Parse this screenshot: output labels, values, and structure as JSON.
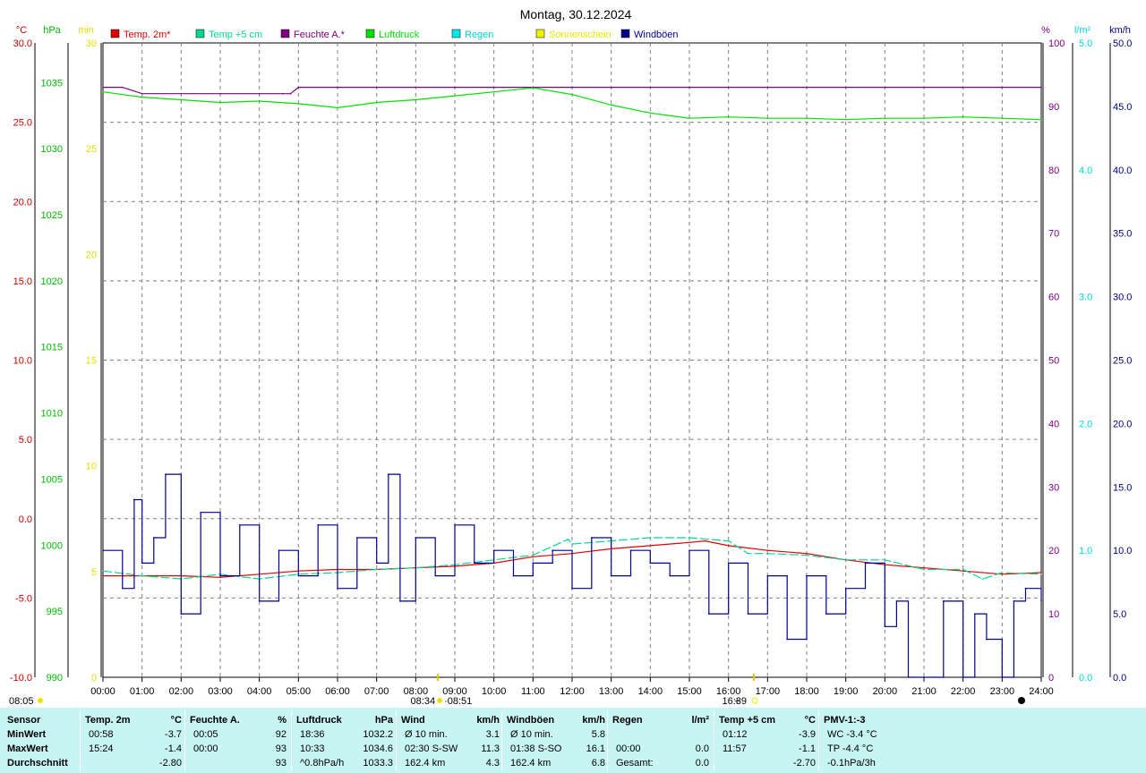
{
  "chart_data": {
    "type": "line",
    "title": "Montag, 30.12.2024",
    "x_ticks": [
      "00:00",
      "01:00",
      "02:00",
      "03:00",
      "04:00",
      "05:00",
      "06:00",
      "07:00",
      "08:00",
      "09:00",
      "10:00",
      "11:00",
      "12:00",
      "13:00",
      "14:00",
      "15:00",
      "16:00",
      "17:00",
      "18:00",
      "19:00",
      "20:00",
      "21:00",
      "22:00",
      "23:00",
      "24:00"
    ],
    "axes": [
      {
        "id": "temp",
        "unit": "°C",
        "color": "#cc0000",
        "min": -10,
        "max": 30,
        "ticks": [
          "-10.0",
          "-5.0",
          "0.0",
          "5.0",
          "10.0",
          "15.0",
          "20.0",
          "25.0",
          "30.0"
        ]
      },
      {
        "id": "press",
        "unit": "hPa",
        "color": "#00b800",
        "min": 990,
        "max": 1038,
        "ticks": [
          "990",
          "995",
          "1000",
          "1005",
          "1010",
          "1015",
          "1020",
          "1025",
          "1030",
          "1035"
        ]
      },
      {
        "id": "sun",
        "unit": "min",
        "color": "#e0e000",
        "min": 0,
        "max": 30,
        "ticks": [
          "0",
          "5",
          "10",
          "15",
          "20",
          "25",
          "30"
        ]
      },
      {
        "id": "hum",
        "unit": "%",
        "color": "#800080",
        "min": 0,
        "max": 100,
        "ticks": [
          "0",
          "10",
          "20",
          "30",
          "40",
          "50",
          "60",
          "70",
          "80",
          "90",
          "100"
        ]
      },
      {
        "id": "rain",
        "unit": "l/m²",
        "color": "#00d8d8",
        "min": 0,
        "max": 5,
        "ticks": [
          "0.0",
          "1.0",
          "2.0",
          "3.0",
          "4.0",
          "5.0"
        ]
      },
      {
        "id": "wind",
        "unit": "km/h",
        "color": "#000080",
        "min": 0,
        "max": 50,
        "ticks": [
          "0.0",
          "5.0",
          "10.0",
          "15.0",
          "20.0",
          "25.0",
          "30.0",
          "35.0",
          "40.0",
          "45.0",
          "50.0"
        ]
      }
    ],
    "legend": [
      {
        "name": "Temp. 2m*",
        "color": "#e00000"
      },
      {
        "name": "Temp +5 cm",
        "color": "#00d890"
      },
      {
        "name": "Feuchte A.*",
        "color": "#800080"
      },
      {
        "name": "Luftdruck",
        "color": "#00e000"
      },
      {
        "name": "Regen",
        "color": "#00e8e8"
      },
      {
        "name": "Sonnenschein",
        "color": "#f0f000"
      },
      {
        "name": "Windböen",
        "color": "#000090"
      }
    ],
    "series": [
      {
        "name": "Temp. 2m*",
        "axis": "temp",
        "color": "#e00000",
        "x": [
          0,
          1,
          2,
          3,
          4,
          5,
          6,
          7,
          8,
          9,
          10,
          11,
          12,
          13,
          14,
          15,
          15.4,
          16,
          17,
          18,
          19,
          20,
          21,
          22,
          23,
          24
        ],
        "y": [
          -3.6,
          -3.6,
          -3.6,
          -3.7,
          -3.5,
          -3.3,
          -3.2,
          -3.2,
          -3.1,
          -3.0,
          -2.8,
          -2.4,
          -2.2,
          -1.9,
          -1.7,
          -1.5,
          -1.4,
          -1.7,
          -2.0,
          -2.2,
          -2.6,
          -2.9,
          -3.1,
          -3.3,
          -3.5,
          -3.4
        ]
      },
      {
        "name": "Temp +5 cm",
        "axis": "temp",
        "color": "#00d890",
        "x": [
          0,
          1,
          2,
          3,
          4,
          5,
          6,
          7,
          8,
          9,
          10,
          11,
          11.9,
          12,
          13,
          14,
          15,
          16,
          16.5,
          17,
          18,
          19,
          20,
          21,
          22,
          22.5,
          23,
          24
        ],
        "y": [
          -3.3,
          -3.6,
          -3.8,
          -3.5,
          -3.8,
          -3.5,
          -3.4,
          -3.2,
          -3.1,
          -2.9,
          -2.6,
          -2.3,
          -1.3,
          -1.6,
          -1.4,
          -1.2,
          -1.2,
          -1.4,
          -2.2,
          -2.2,
          -2.3,
          -2.6,
          -2.6,
          -3.2,
          -3.2,
          -3.8,
          -3.4,
          -3.5
        ]
      },
      {
        "name": "Feuchte A.*",
        "axis": "hum",
        "color": "#800080",
        "x": [
          0,
          0.5,
          1,
          2,
          3,
          4,
          4.6,
          4.8,
          5,
          6,
          7,
          8,
          9,
          10,
          11,
          12,
          13,
          14,
          15,
          16,
          17,
          18,
          19,
          20,
          21,
          22,
          23,
          24
        ],
        "y": [
          93,
          93,
          92,
          92,
          92,
          92,
          92,
          92,
          93,
          93,
          93,
          93,
          93,
          93,
          93,
          93,
          93,
          93,
          93,
          93,
          93,
          93,
          93,
          93,
          93,
          93,
          93,
          93
        ]
      },
      {
        "name": "Luftdruck",
        "axis": "press",
        "color": "#00e000",
        "x": [
          0,
          1,
          2,
          3,
          4,
          5,
          6,
          7,
          8,
          9,
          10,
          11,
          12,
          13,
          14,
          15,
          16,
          17,
          18,
          19,
          20,
          21,
          22,
          23,
          24
        ],
        "y": [
          1034.3,
          1033.9,
          1033.7,
          1033.5,
          1033.6,
          1033.4,
          1033.1,
          1033.5,
          1033.7,
          1034.0,
          1034.3,
          1034.6,
          1034.1,
          1033.3,
          1032.7,
          1032.3,
          1032.4,
          1032.3,
          1032.3,
          1032.2,
          1032.3,
          1032.3,
          1032.4,
          1032.3,
          1032.2
        ]
      },
      {
        "name": "Windböen",
        "axis": "wind",
        "color": "#000090",
        "x": [
          0,
          0.5,
          0.8,
          1,
          1.3,
          1.6,
          2,
          2.5,
          3,
          3.5,
          4,
          4.5,
          5,
          5.5,
          6,
          6.5,
          7,
          7.3,
          7.6,
          8,
          8.5,
          9,
          9.5,
          10,
          10.5,
          11,
          11.5,
          12,
          12.5,
          13,
          13.5,
          14,
          14.5,
          15,
          15.5,
          16,
          16.5,
          17,
          17.5,
          18,
          18.5,
          19,
          19.5,
          20,
          20.3,
          20.6,
          21,
          21.5,
          22,
          22.3,
          22.6,
          23,
          23.3,
          23.6,
          24
        ],
        "y": [
          10,
          7,
          14,
          9,
          11,
          16,
          5,
          13,
          8,
          12,
          6,
          10,
          8,
          12,
          7,
          11,
          9,
          16,
          6,
          11,
          8,
          12,
          9,
          10,
          8,
          9,
          10,
          7,
          11,
          8,
          10,
          9,
          8,
          10,
          5,
          9,
          5,
          8,
          3,
          8,
          5,
          7,
          9,
          4,
          6,
          0,
          0,
          6,
          0,
          5,
          3,
          0,
          6,
          7,
          6
        ]
      }
    ],
    "annotations": {
      "sunrise": "08:34",
      "sunrise_suffix": "·08:51",
      "sunset": "16:39",
      "sunset_prefix": "+",
      "sunshine_start": "08:05"
    }
  },
  "stats": {
    "columns": [
      {
        "header": "Sensor",
        "unit": "",
        "rows": [
          "MinWert",
          "MaxWert",
          "Durchschnitt"
        ]
      },
      {
        "header": "Temp. 2m",
        "unit": "°C",
        "rows": [
          [
            "00:58",
            "-3.7"
          ],
          [
            "15:24",
            "-1.4"
          ],
          [
            "",
            "-2.80"
          ]
        ]
      },
      {
        "header": "Feuchte A.",
        "unit": "%",
        "rows": [
          [
            "00:05",
            "92"
          ],
          [
            "00:00",
            "93"
          ],
          [
            "",
            "93"
          ]
        ]
      },
      {
        "header": "Luftdruck",
        "unit": "hPa",
        "rows": [
          [
            "18:36",
            "1032.2"
          ],
          [
            "10:33",
            "1034.6"
          ],
          [
            "^0.8hPa/h",
            "1033.3"
          ]
        ]
      },
      {
        "header": "Wind",
        "unit": "km/h",
        "rows": [
          [
            "Ø 10 min.",
            "3.1"
          ],
          [
            "02:30  S-SW",
            "11.3"
          ],
          [
            "162.4 km",
            "4.3"
          ]
        ]
      },
      {
        "header": "Windböen",
        "unit": "km/h",
        "rows": [
          [
            "Ø 10 min.",
            "5.8"
          ],
          [
            "01:38  S-SO",
            "16.1"
          ],
          [
            "162.4 km",
            "6.8"
          ]
        ]
      },
      {
        "header": "Regen",
        "unit": "l/m²",
        "rows": [
          [
            "",
            ""
          ],
          [
            "00:00",
            "0.0"
          ],
          [
            "Gesamt:",
            "0.0"
          ]
        ]
      },
      {
        "header": "Temp +5 cm",
        "unit": "°C",
        "rows": [
          [
            "01:12",
            "-3.9"
          ],
          [
            "11:57",
            "-1.1"
          ],
          [
            "",
            "-2.70"
          ]
        ]
      },
      {
        "header": "PMV-1:-3",
        "unit": "",
        "rows": [
          [
            "WC -3.4 °C",
            ""
          ],
          [
            "TP -4.4 °C",
            ""
          ],
          [
            "-0.1hPa/3h",
            ""
          ]
        ]
      }
    ]
  }
}
